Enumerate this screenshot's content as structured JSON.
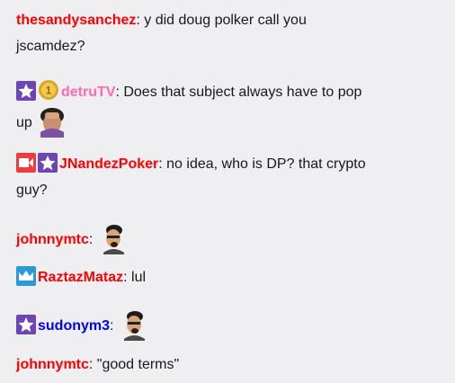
{
  "messages": [
    {
      "user": "thesandysanchez",
      "color": "#ff0000",
      "sep": ": ",
      "text": "y did doug polker call you",
      "text2": "jscamdez?"
    },
    {
      "user": "detruTV",
      "color": "#ff69b4",
      "sep": ": ",
      "text": "Does that subject always have to pop",
      "text2": "up",
      "badges": [
        "subscriber-star-icon",
        "bits-coin-icon"
      ],
      "emote": "facepalm-emote"
    },
    {
      "user": "JNandezPoker",
      "color": "#ff0000",
      "sep": ": ",
      "text": "no idea, who is DP? that crypto",
      "text2": "guy?",
      "badges": [
        "camera-icon",
        "subscriber-star-icon"
      ]
    },
    {
      "user": "johnnymtc",
      "color": "#ff0000",
      "sep": ": ",
      "emote": "singing-man-emote"
    },
    {
      "user": "RaztazMataz",
      "color": "#ff0000",
      "sep": ": ",
      "text": "lul",
      "badges": [
        "prime-crown-icon"
      ]
    },
    {
      "user": "sudonym3",
      "color": "#0000ff",
      "sep": ": ",
      "badges": [
        "subscriber-star-icon"
      ],
      "emote": "singing-man-emote"
    },
    {
      "user": "johnnymtc",
      "color": "#ff0000",
      "sep": ": ",
      "text": "\"good terms\""
    }
  ]
}
